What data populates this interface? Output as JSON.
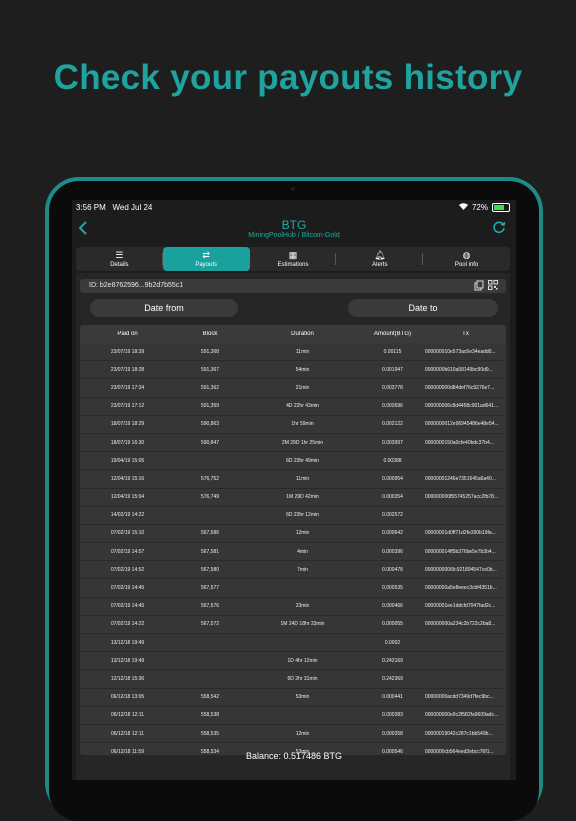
{
  "headline": "Check your payouts history",
  "status": {
    "time": "3:56 PM",
    "date": "Wed Jul 24",
    "battery": "72%",
    "battery_level": 0.72
  },
  "nav": {
    "title": "BTG",
    "subtitle": "MiningPoolHub / Bitcoin-Gold"
  },
  "tabs": [
    {
      "label": "Details",
      "icon": "list-icon"
    },
    {
      "label": "Payouts",
      "icon": "transfer-icon"
    },
    {
      "label": "Estimations",
      "icon": "calculator-icon"
    },
    {
      "label": "Alerts",
      "icon": "bell-icon"
    },
    {
      "label": "Pool info",
      "icon": "globe-icon"
    }
  ],
  "id_bar": {
    "text": "ID:   b2e8762596...9b2d7b55c1"
  },
  "date_from": "Date from",
  "date_to": "Date to",
  "table": {
    "headers": [
      "Paid on",
      "Block",
      "Duration",
      "Amount(BTG)",
      "Tx"
    ],
    "rows": [
      [
        "23/07/19 18:39",
        "591,368",
        "11min",
        "0.00115",
        "000000010e573ac6e34eadd0..."
      ],
      [
        "23/07/19 18:28",
        "591,367",
        "54min",
        "0.001947",
        "0000000b610a58149bc90d9..."
      ],
      [
        "23/07/19 17:34",
        "591,362",
        "21min",
        "0.003778",
        "000000000d84def76c9276e7..."
      ],
      [
        "23/07/19 17:12",
        "591,359",
        "4D 22hr 43min",
        "0.003696",
        "000000006c8d4458c901ad641..."
      ],
      [
        "18/07/19 18:29",
        "590,863",
        "1hr 59min",
        "0.002122",
        "0000000012e96945486e48e54..."
      ],
      [
        "18/07/19 16:30",
        "590,847",
        "2M 29D 1hr 25min",
        "0.003997",
        "0000000150a0cfe40bdc37b4..."
      ],
      [
        "19/04/19 15:05",
        "",
        "6D 23hr 49min",
        "0.00388",
        ""
      ],
      [
        "12/04/19 15:16",
        "576,752",
        "11min",
        "0.000954",
        "00000001246e7351645a6a40..."
      ],
      [
        "12/04/19 15:04",
        "576,749",
        "1M 29D 42min",
        "0.000354",
        "000000000f55745257acc2fb78..."
      ],
      [
        "14/02/19 14:22",
        "",
        "6D 23hr 12min",
        "0.002572",
        ""
      ],
      [
        "07/02/19 15:10",
        "567,586",
        "12min",
        "0.000642",
        "00000001d0ff71d2fe390b19fa..."
      ],
      [
        "07/02/19 14:57",
        "567,581",
        "4min",
        "0.000396",
        "000000014ff5b376be5e7b3b4..."
      ],
      [
        "07/02/19 14:52",
        "567,580",
        "7min",
        "0.000478",
        "0000000006fc921894547ce0b..."
      ],
      [
        "07/02/19 14:45",
        "567,577",
        "",
        "0.000535",
        "00000000a5e8eeec3cbf4351b..."
      ],
      [
        "07/02/19 14:45",
        "567,576",
        "23min",
        "0.000466",
        "00000001ee1ddcfd7047fad2c..."
      ],
      [
        "07/02/19 14:22",
        "567,572",
        "1M 24D 18hr 33min",
        "0.000055",
        "000000000a234c2b722c2ba8..."
      ],
      [
        "13/12/18 19:49",
        "",
        "",
        "0.0002",
        ""
      ],
      [
        "13/12/18 19:49",
        "",
        "1D 4hr 12min",
        "0.242169",
        ""
      ],
      [
        "12/12/18 15:36",
        "",
        "6D 2hr 31min",
        "0.242369",
        ""
      ],
      [
        "06/12/18 13:05",
        "558,542",
        "53min",
        "0.000441",
        "00000000acdd7349d7fec9bc..."
      ],
      [
        "06/12/18 12:11",
        "558,538",
        "",
        "0.000383",
        "000000000e9c2f582fa9609adc..."
      ],
      [
        "06/12/18 12:11",
        "558,535",
        "12min",
        "0.000358",
        "00000019042c287c1bb549b..."
      ],
      [
        "06/12/18 11:59",
        "558,534",
        "53min",
        "0.000546",
        "0000000cb564eed3ebcc76f1..."
      ]
    ]
  },
  "balance": "Balance: 0.517486 BTG",
  "colors": {
    "accent": "#1fa39f",
    "background": "#1e1e1e",
    "device_frame": "#1d8c89"
  }
}
